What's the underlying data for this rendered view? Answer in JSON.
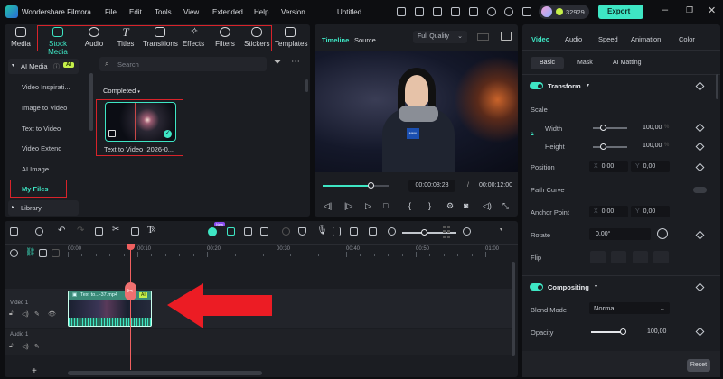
{
  "app": {
    "title": "Wondershare Filmora",
    "document": "Untitled",
    "credits": "32929",
    "export_label": "Export",
    "menu": [
      "File",
      "Edit",
      "Tools",
      "View",
      "Extended",
      "Help",
      "Version"
    ]
  },
  "media_tabs": [
    "Media",
    "Stock Media",
    "Audio",
    "Titles",
    "Transitions",
    "Effects",
    "Filters",
    "Stickers",
    "Templates"
  ],
  "sidebar": {
    "section": "AI Media",
    "badge": "AI",
    "items": [
      "Video Inspirati...",
      "Image to Video",
      "Text to Video",
      "Video Extend",
      "AI Image",
      "My Files"
    ],
    "library": "Library"
  },
  "browser": {
    "search_placeholder": "Search",
    "filter_label": "Completed",
    "clip_name": "Text to Video_2026-0..."
  },
  "preview": {
    "tabs": [
      "Timeline",
      "Source"
    ],
    "quality": "Full Quality",
    "current_time": "00:00:08:28",
    "separator": "/",
    "total_time": "00:00:12:00",
    "progress": 0.74
  },
  "properties": {
    "tabs": [
      "Video",
      "Audio",
      "Speed",
      "Animation",
      "Color"
    ],
    "subtabs": [
      "Basic",
      "Mask",
      "AI Matting"
    ],
    "transform": "Transform",
    "scale": "Scale",
    "width_label": "Width",
    "width_value": "100,00",
    "height_label": "Height",
    "height_value": "100,00",
    "percent": "%",
    "position": "Position",
    "pos_x": "0,00",
    "pos_y": "0,00",
    "x": "X",
    "y": "Y",
    "path_curve": "Path Curve",
    "anchor": "Anchor Point",
    "anchor_x": "0,00",
    "anchor_y": "0,00",
    "rotate": "Rotate",
    "rotate_value": "0,00°",
    "flip": "Flip",
    "compositing": "Compositing",
    "blend_mode": "Blend Mode",
    "blend_value": "Normal",
    "opacity": "Opacity",
    "opacity_value": "100,00",
    "reset": "Reset"
  },
  "timeline": {
    "ruler": [
      "00:00",
      "00:10",
      "00:20",
      "00:30",
      "00:40",
      "00:50",
      "01:00"
    ],
    "video_track": "Video 1",
    "audio_track": "Audio 1",
    "clip_label": "Text to...-37.mp4",
    "clip_badge": "AI",
    "new_badge": "New",
    "playhead_seconds": 8.9
  },
  "colors": {
    "accent": "#3ee6c4",
    "highlight": "#d8232a"
  }
}
